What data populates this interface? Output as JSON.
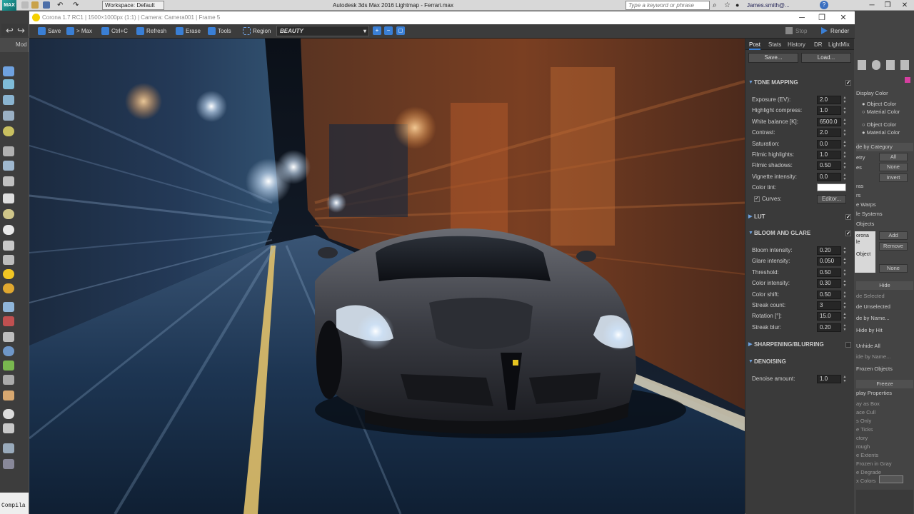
{
  "max": {
    "logo": "MAX",
    "workspace": "Workspace: Default",
    "app_title": "Autodesk 3ds Max 2016     Lightmap - Ferrari.max",
    "search_placeholder": "Type a keyword or phrase",
    "user": "James.smith@...",
    "win_min": "─",
    "win_max": "❐",
    "win_close": "✕",
    "listener": "Compila"
  },
  "vfb": {
    "title": "Corona 1.7 RC1 | 1500×1000px (1:1) | Camera: Camera001 | Frame 5",
    "toolbar": {
      "save": "Save",
      "to_max": "> Max",
      "copy": "Ctrl+C",
      "refresh": "Refresh",
      "erase": "Erase",
      "tools": "Tools",
      "region": "Region",
      "beauty": "BEAUTY",
      "beauty_arrow": "▾",
      "stop": "Stop",
      "render": "Render"
    },
    "panel": {
      "tabs": [
        "Post",
        "Stats",
        "History",
        "DR",
        "LightMix"
      ],
      "save": "Save...",
      "load": "Load...",
      "tone_mapping": {
        "title": "TONE MAPPING",
        "checked": "✓",
        "rows": [
          {
            "label": "Exposure (EV):",
            "value": "2.0"
          },
          {
            "label": "Highlight compress:",
            "value": "1.0"
          },
          {
            "label": "White balance [K]:",
            "value": "6500.0"
          },
          {
            "label": "Contrast:",
            "value": "2.0"
          },
          {
            "label": "Saturation:",
            "value": "0.0"
          },
          {
            "label": "Filmic highlights:",
            "value": "1.0"
          },
          {
            "label": "Filmic shadows:",
            "value": "0.50"
          },
          {
            "label": "Vignette intensity:",
            "value": "0.0"
          }
        ],
        "color_tint": "Color tint:",
        "curves": "Curves:",
        "curves_checked": "✓",
        "editor": "Editor..."
      },
      "lut": {
        "title": "LUT",
        "checked": "✓"
      },
      "bloom": {
        "title": "BLOOM AND GLARE",
        "checked": "✓",
        "rows": [
          {
            "label": "Bloom intensity:",
            "value": "0.20"
          },
          {
            "label": "Glare intensity:",
            "value": "0.050"
          },
          {
            "label": "Threshold:",
            "value": "0.50"
          },
          {
            "label": "Color intensity:",
            "value": "0.30"
          },
          {
            "label": "Color shift:",
            "value": "0.50"
          },
          {
            "label": "Streak count:",
            "value": "3"
          },
          {
            "label": "Rotation [°]:",
            "value": "15.0"
          },
          {
            "label": "Streak blur:",
            "value": "0.20"
          }
        ]
      },
      "sharpening": {
        "title": "SHARPENING/BLURRING"
      },
      "denoising": {
        "title": "DENOISING",
        "rows": [
          {
            "label": "Denoise amount:",
            "value": "1.0"
          }
        ]
      },
      "arrow_open": "▼",
      "arrow_closed": "▶",
      "spin_up": "▲",
      "spin_down": "▼"
    }
  },
  "cmd": {
    "display_color": "Display Color",
    "wire_object": "Object Color",
    "wire_material": "Material Color",
    "shaded_object": "Object Color",
    "shaded_material": "Material Color",
    "hide_by_category": "de by Category",
    "cat_items": [
      "etry",
      "es",
      "ras",
      "rs",
      "e Warps",
      "le Systems",
      "Objects"
    ],
    "all": "All",
    "none": "None",
    "invert": "Invert",
    "list_items": [
      "orona",
      "le",
      "Object"
    ],
    "add": "Add",
    "remove": "Remove",
    "none2": "None",
    "hide": "Hide",
    "hide_items": [
      "de Selected",
      "de Unselected",
      "de by Name...",
      "Hide by Hit",
      "Unhide All",
      "ide by Name...",
      "Frozen Objects"
    ],
    "freeze": "Freeze",
    "display_props": "play Properties",
    "props": [
      "ay as Box",
      "ace Cull",
      "s Only",
      "e Ticks",
      "ctory",
      "rough",
      "e Extents",
      "Frozen in Gray",
      "e Degrade",
      "x Colors"
    ]
  },
  "colors": {
    "accent": "#3a7fd5",
    "panel_bg": "#3a3a3a",
    "title_bar": "#ffffff"
  }
}
